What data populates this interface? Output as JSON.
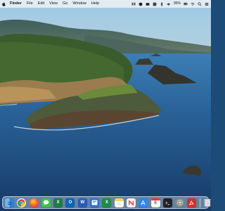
{
  "menubar": {
    "items": [
      "Finder",
      "File",
      "Edit",
      "View",
      "Go",
      "Window",
      "Help"
    ],
    "battery_percent": "96%"
  },
  "desktop": {
    "wallpaper": "coastal-cliffs-island-ocean"
  },
  "dock": {
    "apps": [
      {
        "name": "finder-icon",
        "color": "#3d8ee8"
      },
      {
        "name": "chrome-icon",
        "color": "#ffffff"
      },
      {
        "name": "firefox-icon",
        "color": "#e66a1f"
      },
      {
        "name": "messages-icon",
        "color": "#3fc24a"
      },
      {
        "name": "excel-icon",
        "color": "#1f7a45"
      },
      {
        "name": "outlook-icon",
        "color": "#0f63b8"
      },
      {
        "name": "word-icon",
        "color": "#2a5cb8"
      },
      {
        "name": "powerpoint-icon",
        "color": "#2f6fd0"
      },
      {
        "name": "excel-icon-2",
        "color": "#1e8a4a"
      },
      {
        "name": "notes-icon",
        "color": "#f5d35a"
      },
      {
        "name": "news-icon",
        "color": "#f2f2f2"
      },
      {
        "name": "appstore-icon",
        "color": "#2f86f0"
      },
      {
        "name": "calendar-icon",
        "color": "#f7f7f7"
      },
      {
        "name": "terminal-icon",
        "color": "#222222"
      },
      {
        "name": "system-preferences-icon",
        "color": "#8b8b8b"
      },
      {
        "name": "acrobat-icon",
        "color": "#d32f2f"
      },
      {
        "name": "trash-icon",
        "color": "#e5e8ec"
      }
    ],
    "calendar_day": "6"
  }
}
